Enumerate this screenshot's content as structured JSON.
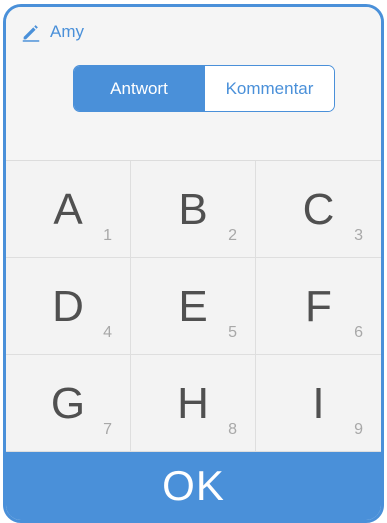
{
  "user": {
    "name": "Amy",
    "icon": "pencil-icon"
  },
  "mode": {
    "options": [
      {
        "label": "Antwort",
        "active": true
      },
      {
        "label": "Kommentar",
        "active": false
      }
    ]
  },
  "keys": [
    {
      "letter": "A",
      "number": "1"
    },
    {
      "letter": "B",
      "number": "2"
    },
    {
      "letter": "C",
      "number": "3"
    },
    {
      "letter": "D",
      "number": "4"
    },
    {
      "letter": "E",
      "number": "5"
    },
    {
      "letter": "F",
      "number": "6"
    },
    {
      "letter": "G",
      "number": "7"
    },
    {
      "letter": "H",
      "number": "8"
    },
    {
      "letter": "I",
      "number": "9"
    }
  ],
  "ok_button": {
    "label": "OK"
  },
  "colors": {
    "accent": "#4a90d9",
    "key_text": "#505050",
    "key_number": "#a8a8a8"
  }
}
